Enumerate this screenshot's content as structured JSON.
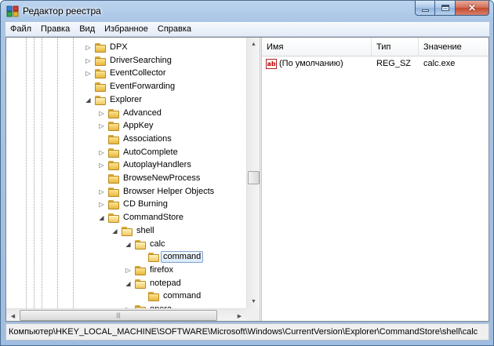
{
  "window": {
    "title": "Редактор реестра"
  },
  "menu": [
    "Файл",
    "Правка",
    "Вид",
    "Избранное",
    "Справка"
  ],
  "tree": {
    "items": [
      {
        "label": "DPX",
        "expander": "closed",
        "depth": 0,
        "open": false
      },
      {
        "label": "DriverSearching",
        "expander": "closed",
        "depth": 0,
        "open": false
      },
      {
        "label": "EventCollector",
        "expander": "closed",
        "depth": 0,
        "open": false
      },
      {
        "label": "EventForwarding",
        "expander": "none",
        "depth": 0,
        "open": false
      },
      {
        "label": "Explorer",
        "expander": "open",
        "depth": 0,
        "open": true
      },
      {
        "label": "Advanced",
        "expander": "closed",
        "depth": 1,
        "open": false
      },
      {
        "label": "AppKey",
        "expander": "closed",
        "depth": 1,
        "open": false
      },
      {
        "label": "Associations",
        "expander": "none",
        "depth": 1,
        "open": false
      },
      {
        "label": "AutoComplete",
        "expander": "closed",
        "depth": 1,
        "open": false
      },
      {
        "label": "AutoplayHandlers",
        "expander": "closed",
        "depth": 1,
        "open": false
      },
      {
        "label": "BrowseNewProcess",
        "expander": "none",
        "depth": 1,
        "open": false
      },
      {
        "label": "Browser Helper Objects",
        "expander": "closed",
        "depth": 1,
        "open": false
      },
      {
        "label": "CD Burning",
        "expander": "closed",
        "depth": 1,
        "open": false
      },
      {
        "label": "CommandStore",
        "expander": "open",
        "depth": 1,
        "open": true
      },
      {
        "label": "shell",
        "expander": "open",
        "depth": 2,
        "open": true
      },
      {
        "label": "calc",
        "expander": "open",
        "depth": 3,
        "open": true
      },
      {
        "label": "command",
        "expander": "none",
        "depth": 4,
        "open": true,
        "selected": true
      },
      {
        "label": "firefox",
        "expander": "closed",
        "depth": 3,
        "open": false
      },
      {
        "label": "notepad",
        "expander": "open",
        "depth": 3,
        "open": true
      },
      {
        "label": "command",
        "expander": "none",
        "depth": 4,
        "open": false
      },
      {
        "label": "opera",
        "expander": "closed",
        "depth": 3,
        "open": false
      }
    ]
  },
  "list": {
    "columns": [
      "Имя",
      "Тип",
      "Значение"
    ],
    "rows": [
      {
        "name": "(По умолчанию)",
        "type": "REG_SZ",
        "value": "calc.exe",
        "icon": "string-value-icon"
      }
    ]
  },
  "status": {
    "path": "Компьютер\\HKEY_LOCAL_MACHINE\\SOFTWARE\\Microsoft\\Windows\\CurrentVersion\\Explorer\\CommandStore\\shell\\calc"
  },
  "colors": {
    "selection_border": "#7da2ce",
    "titlebar": "#a9c5e6",
    "close_button": "#c34a30"
  }
}
